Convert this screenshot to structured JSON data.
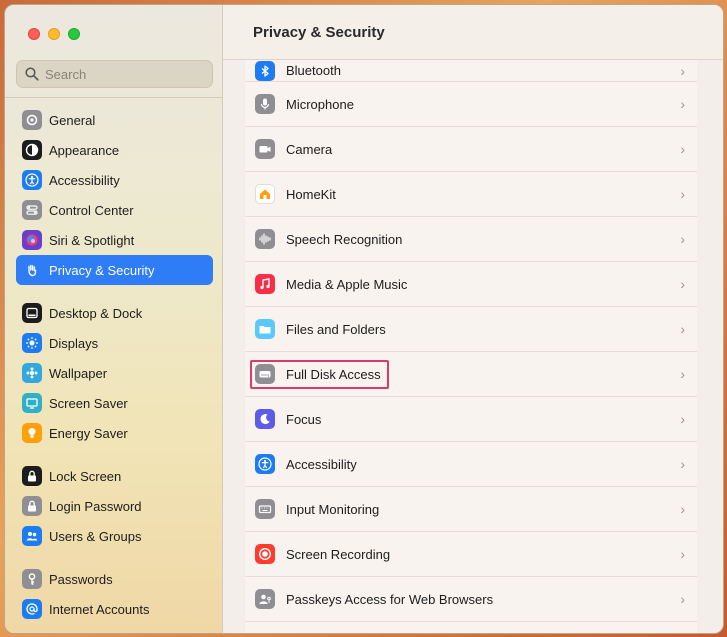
{
  "search": {
    "placeholder": "Search"
  },
  "main": {
    "title": "Privacy & Security"
  },
  "sidebar": {
    "groups": [
      [
        {
          "label": "General",
          "icon": "gear-icon",
          "color": "#8e8e93"
        },
        {
          "label": "Appearance",
          "icon": "appearance-icon",
          "color": "#1c1c1e"
        },
        {
          "label": "Accessibility",
          "icon": "accessibility-icon",
          "color": "#1e7cf2"
        },
        {
          "label": "Control Center",
          "icon": "control-center-icon",
          "color": "#8e8e93"
        },
        {
          "label": "Siri & Spotlight",
          "icon": "siri-icon",
          "color": "#6b3fc7"
        },
        {
          "label": "Privacy & Security",
          "icon": "hand-icon",
          "color": "#2e7cf6",
          "active": true
        }
      ],
      [
        {
          "label": "Desktop & Dock",
          "icon": "dock-icon",
          "color": "#1c1c1e"
        },
        {
          "label": "Displays",
          "icon": "sun-icon",
          "color": "#1e7cf2"
        },
        {
          "label": "Wallpaper",
          "icon": "wallpaper-icon",
          "color": "#31a8e0"
        },
        {
          "label": "Screen Saver",
          "icon": "screen-saver-icon",
          "color": "#30b0c7"
        },
        {
          "label": "Energy Saver",
          "icon": "bulb-icon",
          "color": "#ff9f0a"
        }
      ],
      [
        {
          "label": "Lock Screen",
          "icon": "lock-icon",
          "color": "#1c1c1e"
        },
        {
          "label": "Login Password",
          "icon": "lock-icon",
          "color": "#8e8e93"
        },
        {
          "label": "Users & Groups",
          "icon": "users-icon",
          "color": "#1e7cf2"
        }
      ],
      [
        {
          "label": "Passwords",
          "icon": "key-icon",
          "color": "#8e8e93"
        },
        {
          "label": "Internet Accounts",
          "icon": "at-icon",
          "color": "#1e7cf2"
        }
      ]
    ]
  },
  "list": {
    "items": [
      {
        "label": "Bluetooth",
        "icon": "bluetooth-icon",
        "color": "#1e7cf2"
      },
      {
        "label": "Microphone",
        "icon": "microphone-icon",
        "color": "#8e8e93"
      },
      {
        "label": "Camera",
        "icon": "camera-icon",
        "color": "#8e8e93"
      },
      {
        "label": "HomeKit",
        "icon": "home-icon",
        "color": "#ffffff"
      },
      {
        "label": "Speech Recognition",
        "icon": "waveform-icon",
        "color": "#8e8e93"
      },
      {
        "label": "Media & Apple Music",
        "icon": "music-icon",
        "color": "#fa2d48"
      },
      {
        "label": "Files and Folders",
        "icon": "folder-icon",
        "color": "#5ac8fa"
      },
      {
        "label": "Full Disk Access",
        "icon": "disk-icon",
        "color": "#8e8e93",
        "highlighted": true
      },
      {
        "label": "Focus",
        "icon": "moon-icon",
        "color": "#5e5ce6"
      },
      {
        "label": "Accessibility",
        "icon": "accessibility-icon",
        "color": "#1e7cf2"
      },
      {
        "label": "Input Monitoring",
        "icon": "keyboard-icon",
        "color": "#8e8e93"
      },
      {
        "label": "Screen Recording",
        "icon": "record-icon",
        "color": "#ff3b30"
      },
      {
        "label": "Passkeys Access for Web Browsers",
        "icon": "passkey-icon",
        "color": "#8e8e93"
      }
    ]
  }
}
